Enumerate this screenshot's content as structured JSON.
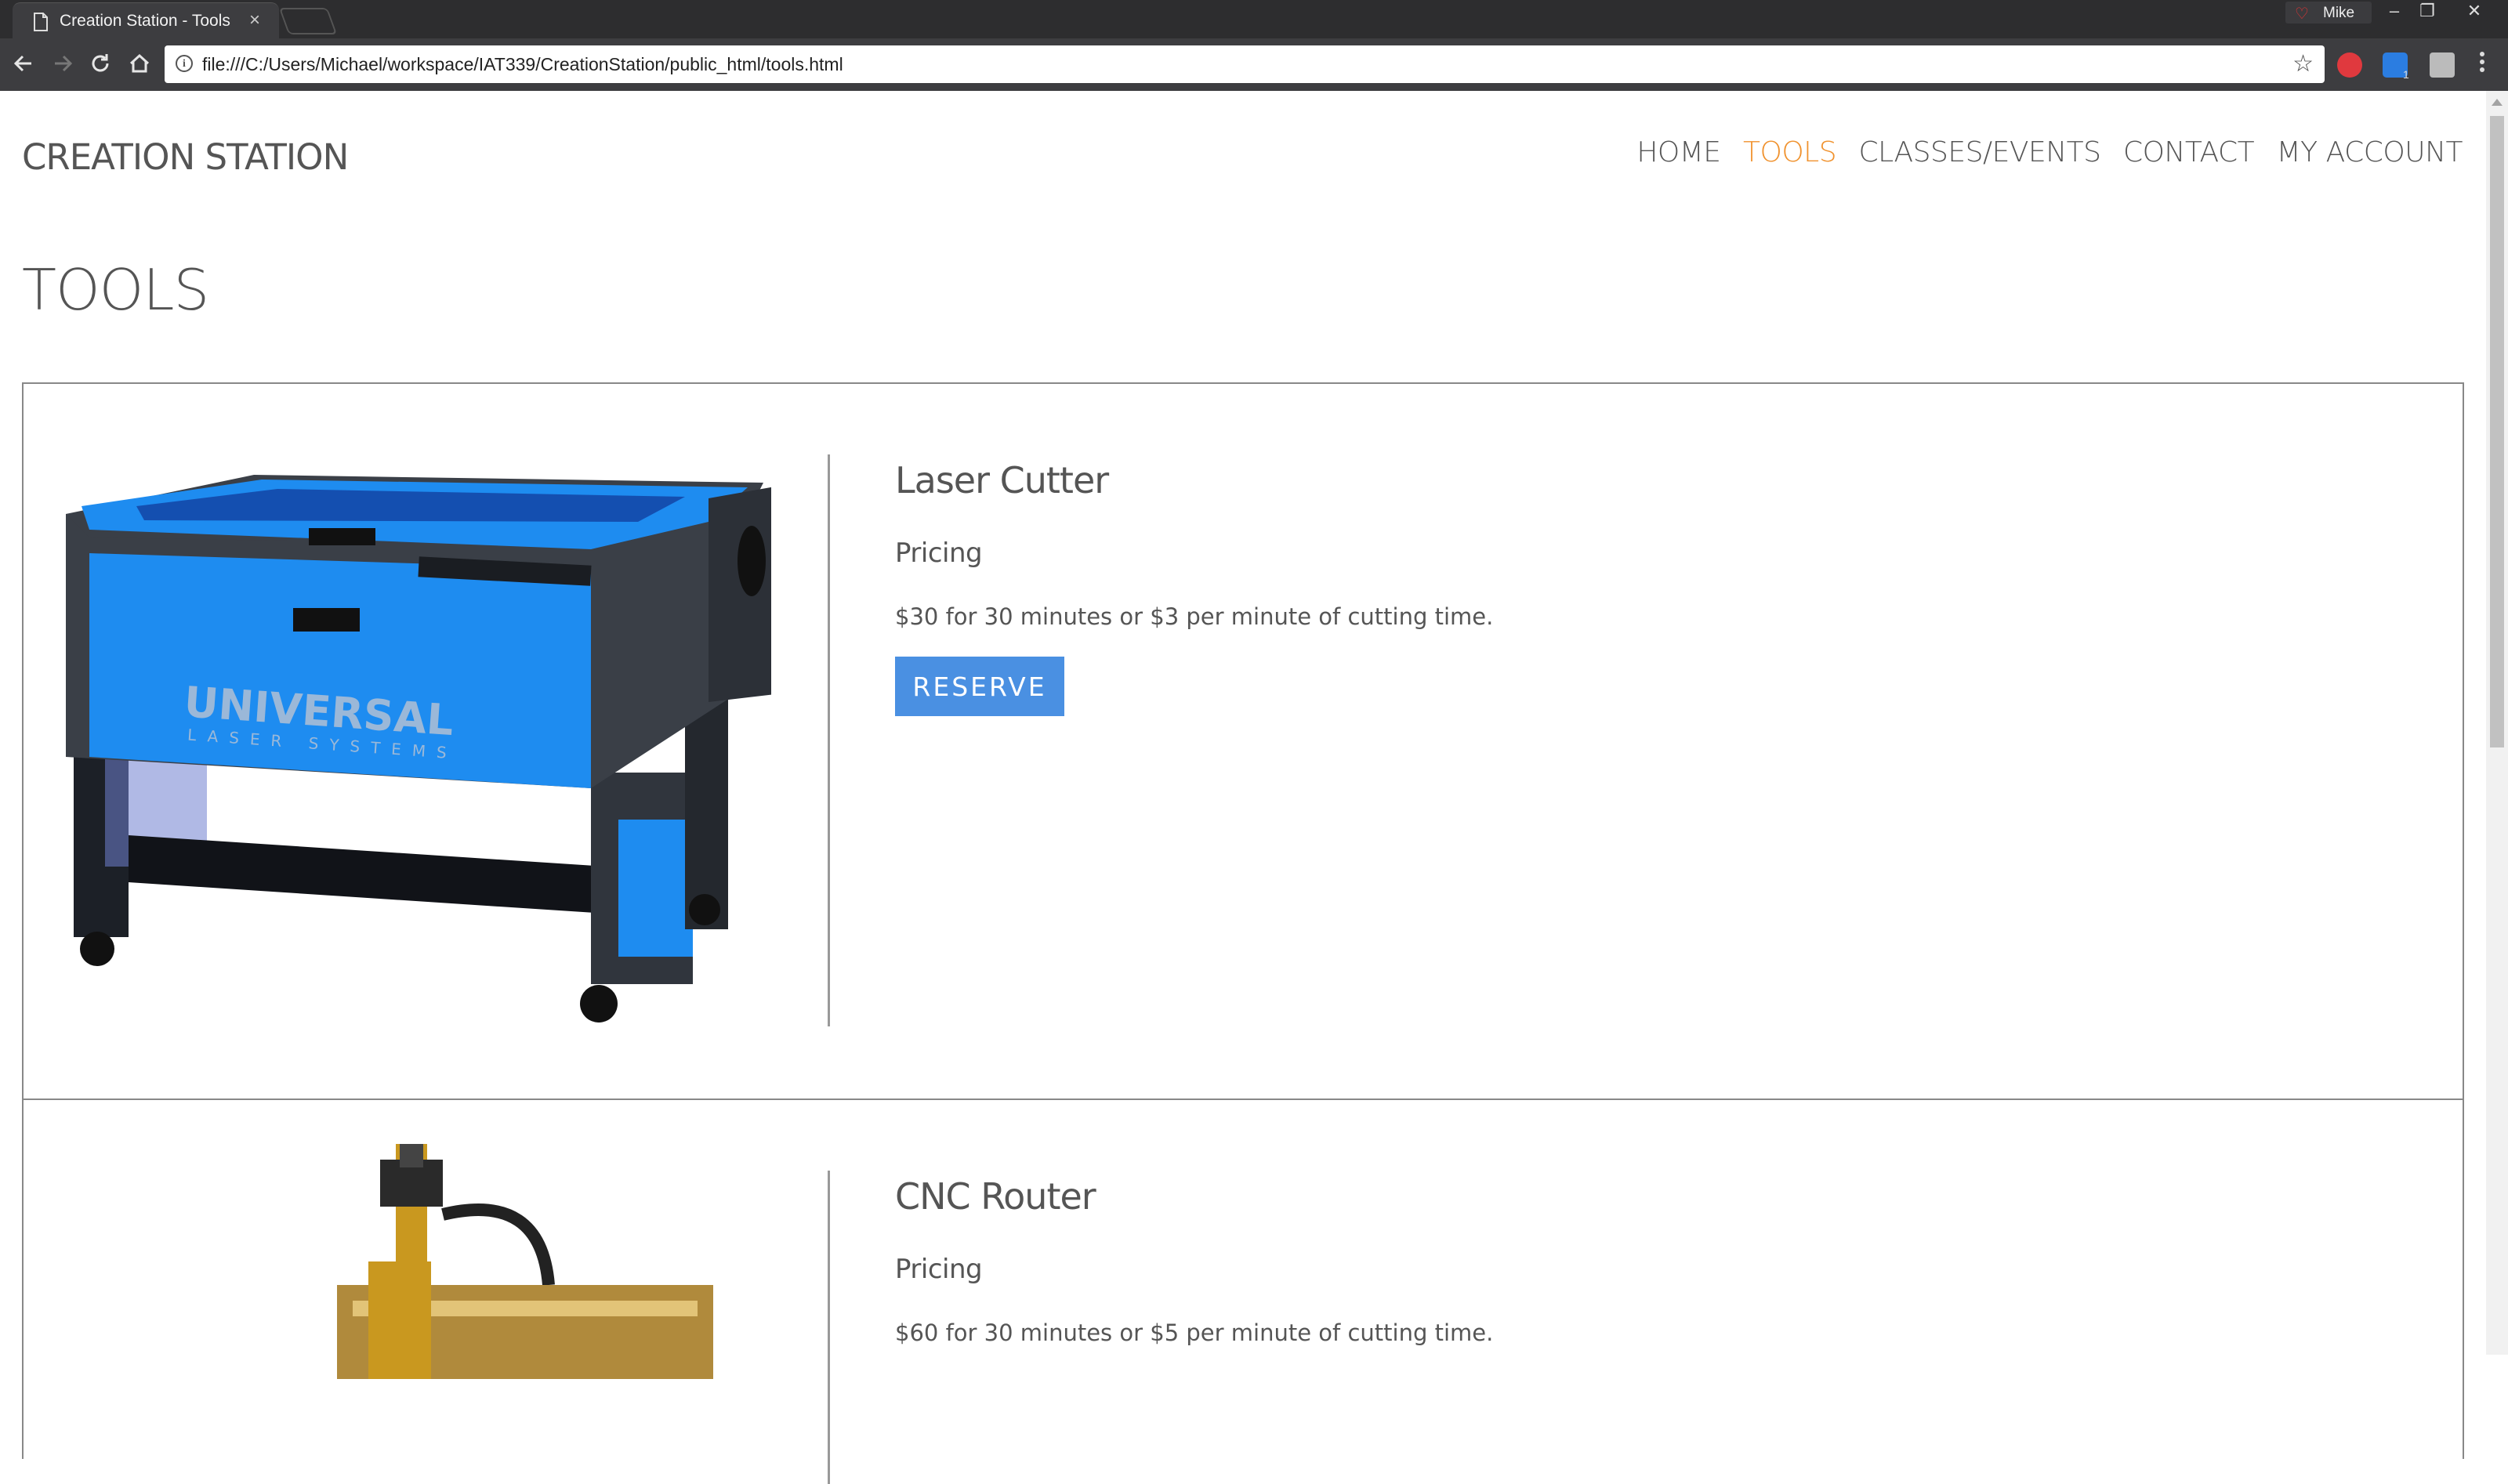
{
  "browser": {
    "tab_title": "Creation Station - Tools",
    "tab_close": "×",
    "profile_name": "Mike",
    "window_controls": [
      "minimize-icon",
      "restore-icon",
      "close-icon"
    ],
    "url": "file:///C:/Users/Michael/workspace/IAT339/CreationStation/public_html/tools.html",
    "extension_badge": "1"
  },
  "site": {
    "brand": "CREATION STATION",
    "nav": [
      {
        "label": "HOME",
        "active": false
      },
      {
        "label": "TOOLS",
        "active": true
      },
      {
        "label": "CLASSES/EVENTS",
        "active": false
      },
      {
        "label": "CONTACT",
        "active": false
      },
      {
        "label": "MY ACCOUNT",
        "active": false
      }
    ],
    "accent_color": "#f0922e",
    "button_color": "#4a90e2"
  },
  "main": {
    "title": "TOOLS",
    "tools": [
      {
        "name": "Laser Cutter",
        "pricing_label": "Pricing",
        "price_text": "$30 for 30 minutes or $3 per minute of cutting time.",
        "button": "RESERVE",
        "image_brand_line1": "UNIVERSAL",
        "image_brand_line2": "LASER SYSTEMS"
      },
      {
        "name": "CNC Router",
        "pricing_label": "Pricing",
        "price_text": "$60 for 30 minutes or $5 per minute of cutting time."
      }
    ]
  }
}
